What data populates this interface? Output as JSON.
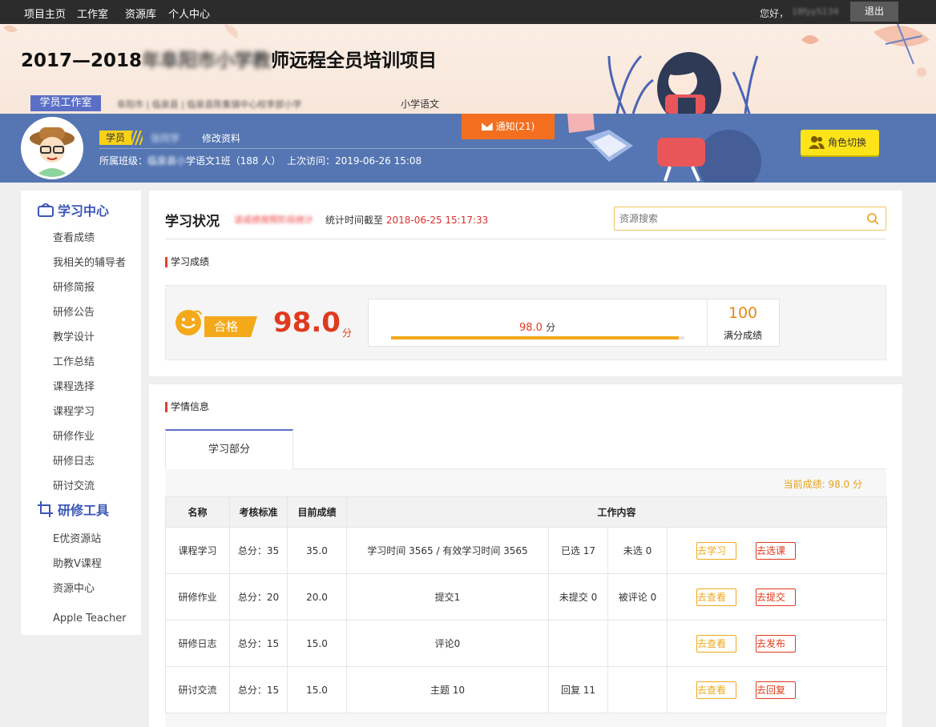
{
  "topnav": {
    "items": [
      "项目主页",
      "工作室",
      "资源库",
      "个人中心"
    ],
    "greeting": "您好，",
    "username": "18fyyS134",
    "logout": "退出"
  },
  "banner": {
    "title_prefix": "2017—2018",
    "title_blurred": "年阜阳市小学教",
    "title_suffix": "师远程全员培训项目",
    "tag": "学员工作室",
    "crumbs": "阜阳市 | 临泉县 | 临泉县陈集镇中心校李部小学",
    "crumbs_tail": "小学语文"
  },
  "profile": {
    "role": "学员",
    "name": "张同学",
    "edit": "修改资料",
    "class_label": "所属班级：",
    "class_blur": "临泉县小",
    "class_text": "学语文1班（188 人）",
    "last_visit": "上次访问：2019-06-26 15:08",
    "notice": "通知(21)",
    "role_switch": "角色切换"
  },
  "sidebar": {
    "section1": "学习中心",
    "items1": [
      "查看成绩",
      "我相关的辅导者",
      "研修简报",
      "研修公告",
      "教学设计",
      "工作总结",
      "课程选择",
      "课程学习",
      "研修作业",
      "研修日志",
      "研讨交流"
    ],
    "section2": "研修工具",
    "items2": [
      "E优资源站",
      "助教V课程",
      "资源中心",
      "Apple Teacher"
    ]
  },
  "status": {
    "heading": "学习状况",
    "blur": "该成绩按照阶段统计",
    "stat_prefix": "统计时间截至",
    "stat_time": "2018-06-25 15:17:33",
    "search_placeholder": "资源搜索"
  },
  "score": {
    "section": "学习成绩",
    "pass": "合格",
    "value": "98.0",
    "unit": "分",
    "bar_value": "98.0",
    "bar_unit": "分",
    "progress": 0.98,
    "full": "100",
    "full_label": "满分成绩"
  },
  "info": {
    "section": "学情信息",
    "tab": "学习部分",
    "current": "当前成绩: 98.0 分",
    "headers": [
      "名称",
      "考核标准",
      "目前成绩",
      "工作内容"
    ],
    "rows": [
      {
        "name": "课程学习",
        "std": "总分：35",
        "cur": "35.0",
        "work": "学习时间 3565 / 有效学习时间 3565",
        "c1": "已选 17",
        "c2": "未选 0",
        "b1": "去学习",
        "b2": "去选课"
      },
      {
        "name": "研修作业",
        "std": "总分：20",
        "cur": "20.0",
        "work": "提交1",
        "c1": "未提交 0",
        "c2": "被评论 0",
        "b1": "去查看",
        "b2": "去提交"
      },
      {
        "name": "研修日志",
        "std": "总分：15",
        "cur": "15.0",
        "work": "评论0",
        "c1": "",
        "c2": "",
        "b1": "去查看",
        "b2": "去发布"
      },
      {
        "name": "研讨交流",
        "std": "总分：15",
        "cur": "15.0",
        "work": "主题 10",
        "c1": "回复 11",
        "c2": "",
        "b1": "去查看",
        "b2": "去回复"
      }
    ]
  }
}
